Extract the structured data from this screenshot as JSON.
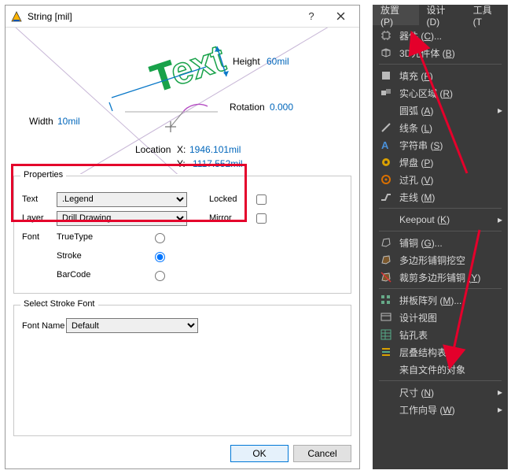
{
  "dialog": {
    "title": "String  [mil]",
    "preview": {
      "text_glyph": "Text",
      "height_label": "Height",
      "height_value": "60mil",
      "rotation_label": "Rotation",
      "rotation_value": "0.000",
      "width_label": "Width",
      "width_value": "10mil",
      "location_label": "Location",
      "x_label": "X:",
      "x_value": "1946.101mil",
      "y_label": "Y:",
      "y_value": "-1117.552mil"
    },
    "properties": {
      "legend": "Properties",
      "text_label": "Text",
      "text_value": ".Legend",
      "layer_label": "Layer",
      "layer_value": "Drill Drawing",
      "font_label": "Font",
      "type_truetype": "TrueType",
      "type_stroke": "Stroke",
      "type_barcode": "BarCode",
      "locked_label": "Locked",
      "mirror_label": "Mirror",
      "selected_font": "stroke",
      "locked": false,
      "mirror": false
    },
    "stroke_font": {
      "legend": "Select Stroke Font",
      "font_name_label": "Font Name",
      "font_name_value": "Default"
    },
    "ok": "OK",
    "cancel": "Cancel"
  },
  "menu": {
    "tabs": [
      {
        "label": "放置 (P)",
        "hotkey": "P",
        "active": true
      },
      {
        "label": "设计 (D)",
        "hotkey": "D",
        "active": false
      },
      {
        "label": "工具 (T",
        "hotkey": "T",
        "active": false
      }
    ],
    "items": [
      {
        "icon": "chip",
        "label": "器件 (C)...",
        "arrow": false
      },
      {
        "icon": "cube3d",
        "label": "3D元件体 (B)",
        "arrow": false
      },
      {
        "sep": true
      },
      {
        "icon": "fill",
        "label": "填充 (F)",
        "arrow": false
      },
      {
        "icon": "solid",
        "label": "实心区域 (R)",
        "arrow": false
      },
      {
        "icon": "",
        "label": "圆弧 (A)",
        "arrow": true
      },
      {
        "icon": "line",
        "label": "线条 (L)",
        "arrow": false
      },
      {
        "icon": "string",
        "label": "字符串 (S)",
        "arrow": false
      },
      {
        "icon": "pad",
        "label": "焊盘 (P)",
        "arrow": false
      },
      {
        "icon": "via",
        "label": "过孔 (V)",
        "arrow": false
      },
      {
        "icon": "track",
        "label": "走线 (M)",
        "arrow": false
      },
      {
        "sep": true
      },
      {
        "icon": "",
        "label": "Keepout (K)",
        "arrow": true
      },
      {
        "sep": true
      },
      {
        "icon": "polygon",
        "label": "铺铜 (G)...",
        "arrow": false
      },
      {
        "icon": "polyfill",
        "label": "多边形铺铜挖空",
        "arrow": false
      },
      {
        "icon": "polycut",
        "label": "裁剪多边形铺铜 (Y)",
        "arrow": false
      },
      {
        "sep": true
      },
      {
        "icon": "array",
        "label": "拼板阵列 (M)...",
        "arrow": false
      },
      {
        "icon": "view",
        "label": "设计视图",
        "arrow": false
      },
      {
        "icon": "drilltable",
        "label": "钻孔表",
        "arrow": false
      },
      {
        "icon": "stackup",
        "label": "层叠结构表",
        "arrow": false
      },
      {
        "icon": "",
        "label": "来自文件的对象",
        "arrow": false
      },
      {
        "sep": true
      },
      {
        "icon": "",
        "label": "尺寸 (N)",
        "arrow": true
      },
      {
        "icon": "",
        "label": "工作向导 (W)",
        "arrow": true
      }
    ]
  }
}
